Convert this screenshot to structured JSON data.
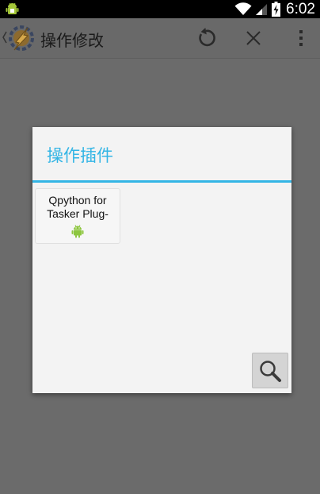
{
  "status_bar": {
    "time": "6:02",
    "icons": [
      "android-debug-icon",
      "wifi-icon",
      "signal-icon",
      "battery-charging-icon"
    ]
  },
  "action_bar": {
    "title": "操作修改",
    "app_icon": "tasker-icon",
    "back_icon": "chevron-left-icon",
    "actions": [
      "refresh-icon",
      "close-icon",
      "overflow-menu-icon"
    ]
  },
  "dialog": {
    "title": "操作插件",
    "accent_color": "#33b5e5",
    "plugins": [
      {
        "name": "Qpython for\nTasker Plug-",
        "icon": "android-icon"
      }
    ],
    "search_icon": "search-icon"
  }
}
